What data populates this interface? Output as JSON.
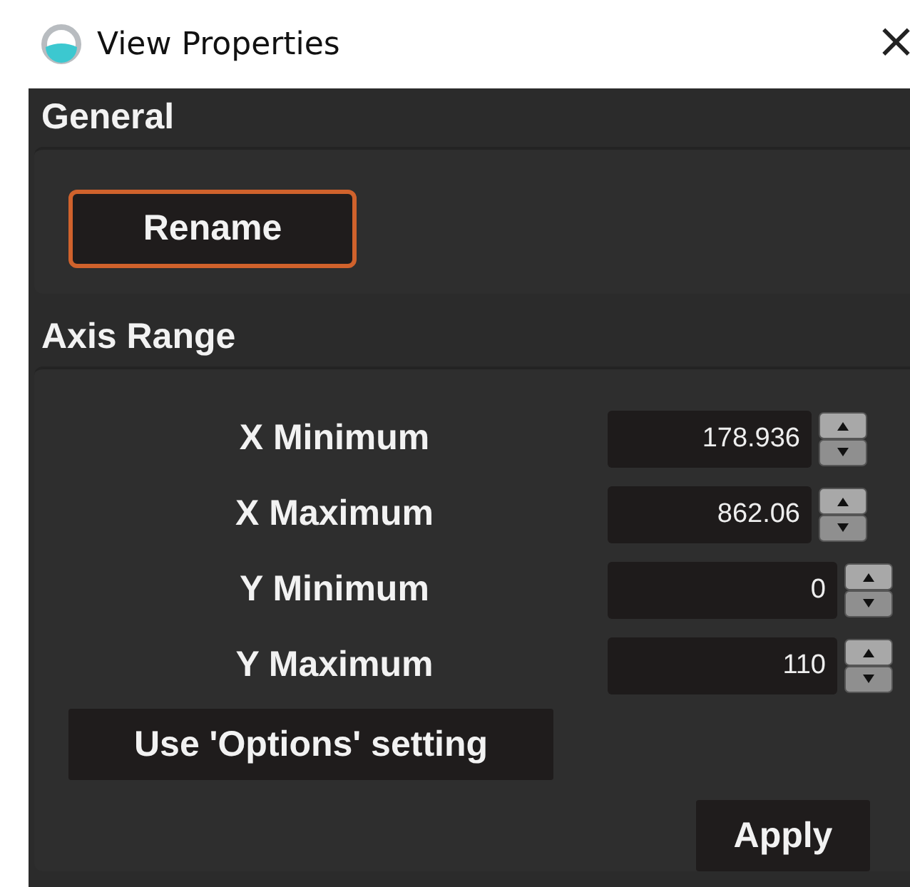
{
  "window": {
    "title": "View Properties",
    "close": "×"
  },
  "general": {
    "heading": "General",
    "rename_button": {
      "label": "Rename",
      "focused": true
    }
  },
  "axis_range": {
    "heading": "Axis Range",
    "fields": [
      {
        "label": "X Minimum",
        "value": "178.936"
      },
      {
        "label": "X Maximum",
        "value": "862.06"
      },
      {
        "label": "Y Minimum",
        "value": "0"
      },
      {
        "label": "Y Maximum",
        "value": "110"
      }
    ],
    "options_button": "Use 'Options' setting",
    "apply_button": "Apply"
  }
}
